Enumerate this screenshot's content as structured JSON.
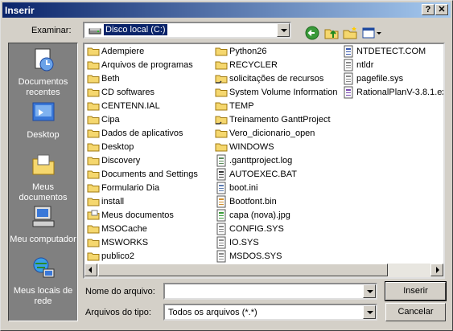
{
  "window": {
    "title": "Inserir",
    "help_button": "?",
    "close_button": "✕"
  },
  "toolbar": {
    "look_in_label": "Examinar:",
    "look_in_value": "Disco local (C:)"
  },
  "places": [
    {
      "label": "Documentos recentes",
      "icon": "recent-documents-icon"
    },
    {
      "label": "Desktop",
      "icon": "desktop-icon"
    },
    {
      "label": "Meus documentos",
      "icon": "my-documents-icon"
    },
    {
      "label": "Meu computador",
      "icon": "my-computer-icon"
    },
    {
      "label": "Meus locais de rede",
      "icon": "network-places-icon"
    }
  ],
  "files": {
    "col1": [
      {
        "name": "Adempiere",
        "type": "folder"
      },
      {
        "name": "Arquivos de programas",
        "type": "folder"
      },
      {
        "name": "Beth",
        "type": "folder"
      },
      {
        "name": "CD softwares",
        "type": "folder"
      },
      {
        "name": "CENTENN.IAL",
        "type": "folder"
      },
      {
        "name": "Cipa",
        "type": "folder"
      },
      {
        "name": "Dados de aplicativos",
        "type": "folder"
      },
      {
        "name": "Desktop",
        "type": "folder"
      },
      {
        "name": "Discovery",
        "type": "folder"
      },
      {
        "name": "Documents and Settings",
        "type": "folder"
      },
      {
        "name": "Formulario Dia",
        "type": "folder"
      },
      {
        "name": "install",
        "type": "folder"
      },
      {
        "name": "Meus documentos",
        "type": "folder-special"
      },
      {
        "name": "MSOCache",
        "type": "folder"
      },
      {
        "name": "MSWORKS",
        "type": "folder"
      },
      {
        "name": "publico2",
        "type": "folder"
      }
    ],
    "col2": [
      {
        "name": "Python26",
        "type": "folder"
      },
      {
        "name": "RECYCLER",
        "type": "folder"
      },
      {
        "name": "solicitações de  recursos",
        "type": "folder-shared"
      },
      {
        "name": "System Volume Information",
        "type": "folder"
      },
      {
        "name": "TEMP",
        "type": "folder"
      },
      {
        "name": "Treinamento GanttProject",
        "type": "folder-shared"
      },
      {
        "name": "Vero_dicionario_open",
        "type": "folder"
      },
      {
        "name": "WINDOWS",
        "type": "folder"
      },
      {
        "name": ".ganttproject.log",
        "type": "log"
      },
      {
        "name": "AUTOEXEC.BAT",
        "type": "bat"
      },
      {
        "name": "boot.ini",
        "type": "ini"
      },
      {
        "name": "Bootfont.bin",
        "type": "bin"
      },
      {
        "name": "capa (nova).jpg",
        "type": "jpg"
      },
      {
        "name": "CONFIG.SYS",
        "type": "sys"
      },
      {
        "name": "IO.SYS",
        "type": "sys"
      },
      {
        "name": "MSDOS.SYS",
        "type": "sys"
      }
    ],
    "col3": [
      {
        "name": "NTDETECT.COM",
        "type": "com"
      },
      {
        "name": "ntldr",
        "type": "sys"
      },
      {
        "name": "pagefile.sys",
        "type": "sys"
      },
      {
        "name": "RationalPlanV-3.8.1.exe",
        "type": "exe"
      }
    ]
  },
  "footer": {
    "filename_label": "Nome do arquivo:",
    "filename_value": "",
    "filetype_label": "Arquivos do tipo:",
    "filetype_value": "Todos os arquivos (*.*)",
    "open_button": "Inserir",
    "cancel_button": "Cancelar"
  },
  "colors": {
    "titlebar_start": "#0a246a",
    "titlebar_end": "#a6caf0",
    "dialog_bg": "#d4d0c8",
    "places_bg": "#808080",
    "folder": "#f5d76e"
  }
}
